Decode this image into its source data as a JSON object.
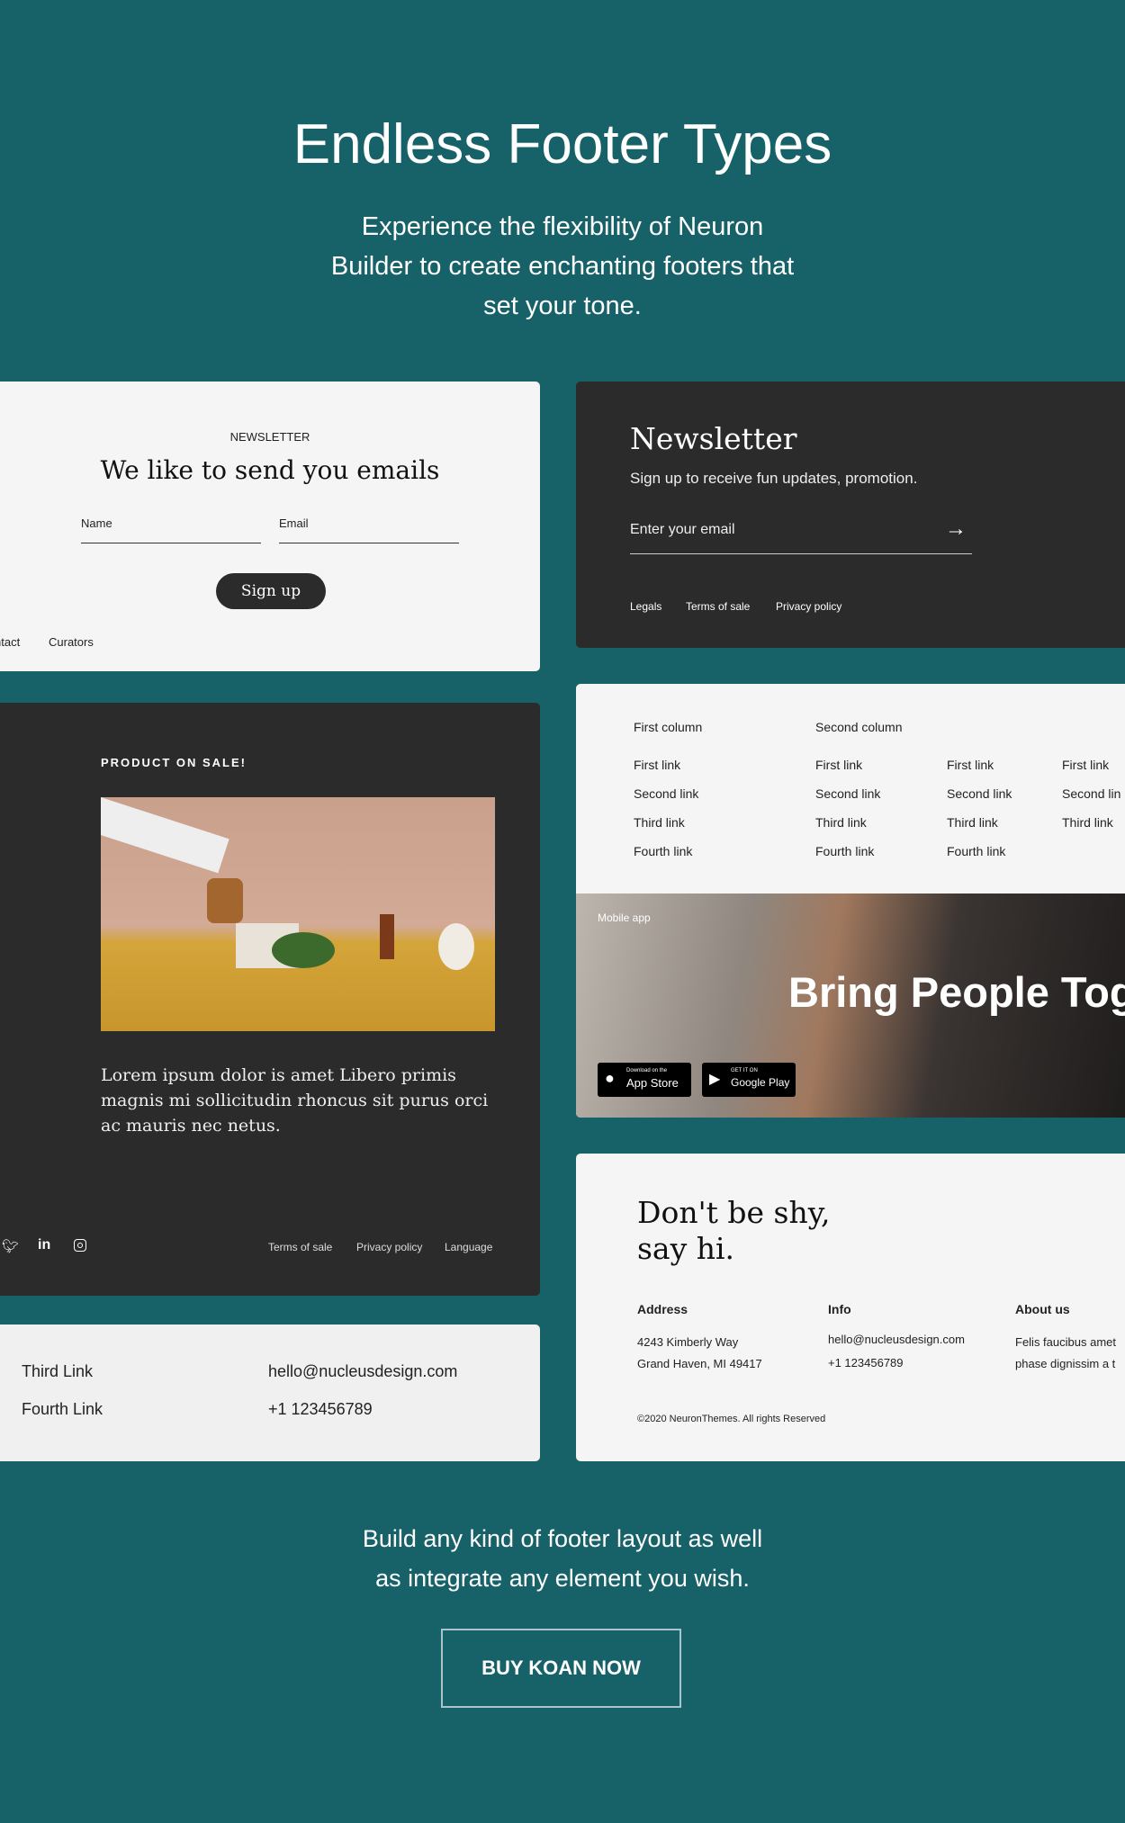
{
  "hero": {
    "title": "Endless Footer Types",
    "subtitle_lines": [
      "Experience the flexibility of Neuron",
      "Builder to create enchanting footers that",
      "set your tone."
    ]
  },
  "card1": {
    "eyebrow": "NEWSLETTER",
    "heading": "We like to send you emails",
    "name_placeholder": "Name",
    "email_placeholder": "Email",
    "button": "Sign up",
    "links": [
      "ntact",
      "Curators"
    ]
  },
  "card2": {
    "heading": "Newsletter",
    "subtitle": "Sign up to receive fun updates, promotion.",
    "email_placeholder": "Enter your email",
    "links": [
      "Legals",
      "Terms of sale",
      "Privacy policy"
    ]
  },
  "card3": {
    "eyebrow": "PRODUCT ON SALE!",
    "body": "Lorem ipsum dolor is amet Libero primis magnis mi sollicitudin rhoncus sit purus orci ac mauris nec netus.",
    "social": [
      "twitter-icon",
      "linkedin-icon",
      "instagram-icon"
    ],
    "links": [
      "Terms of sale",
      "Privacy policy",
      "Language"
    ]
  },
  "card4": {
    "columns": [
      {
        "heading": "First column",
        "links": [
          "First link",
          "Second link",
          "Third link",
          "Fourth link"
        ]
      },
      {
        "heading": "Second column",
        "links": [
          "First link",
          "Second link",
          "Third link",
          "Fourth link"
        ]
      },
      {
        "heading": "",
        "links": [
          "First link",
          "Second link",
          "Third link",
          "Fourth link"
        ]
      },
      {
        "heading": "",
        "links": [
          "First link",
          "Second lin",
          "Third link"
        ]
      }
    ],
    "app_label": "Mobile app",
    "app_heading": "Bring People Tog",
    "appstore": {
      "small": "Download on the",
      "big": "App Store"
    },
    "googleplay": {
      "small": "GET IT ON",
      "big": "Google Play"
    }
  },
  "card5": {
    "links": [
      "Third Link",
      "Fourth Link"
    ],
    "email": "hello@nucleusdesign.com",
    "phone": "+1 123456789"
  },
  "card6": {
    "heading_lines": [
      "Don't be shy,",
      "say hi."
    ],
    "address": {
      "title": "Address",
      "lines": [
        "4243 Kimberly Way",
        "Grand Haven, MI 49417"
      ]
    },
    "info": {
      "title": "Info",
      "lines": [
        "hello@nucleusdesign.com",
        "+1 123456789"
      ]
    },
    "about": {
      "title": "About us",
      "lines": [
        "Felis faucibus amet",
        "phase dignissim a t"
      ]
    },
    "copyright": "©2020 NeuronThemes. All rights Reserved"
  },
  "outro": {
    "lines": [
      "Build any kind of footer layout as well",
      "as integrate any element you wish."
    ],
    "button": "BUY KOAN NOW"
  },
  "colors": {
    "background": "#176168",
    "dark_card": "#2b2b2b",
    "light_card": "#f5f5f5"
  }
}
